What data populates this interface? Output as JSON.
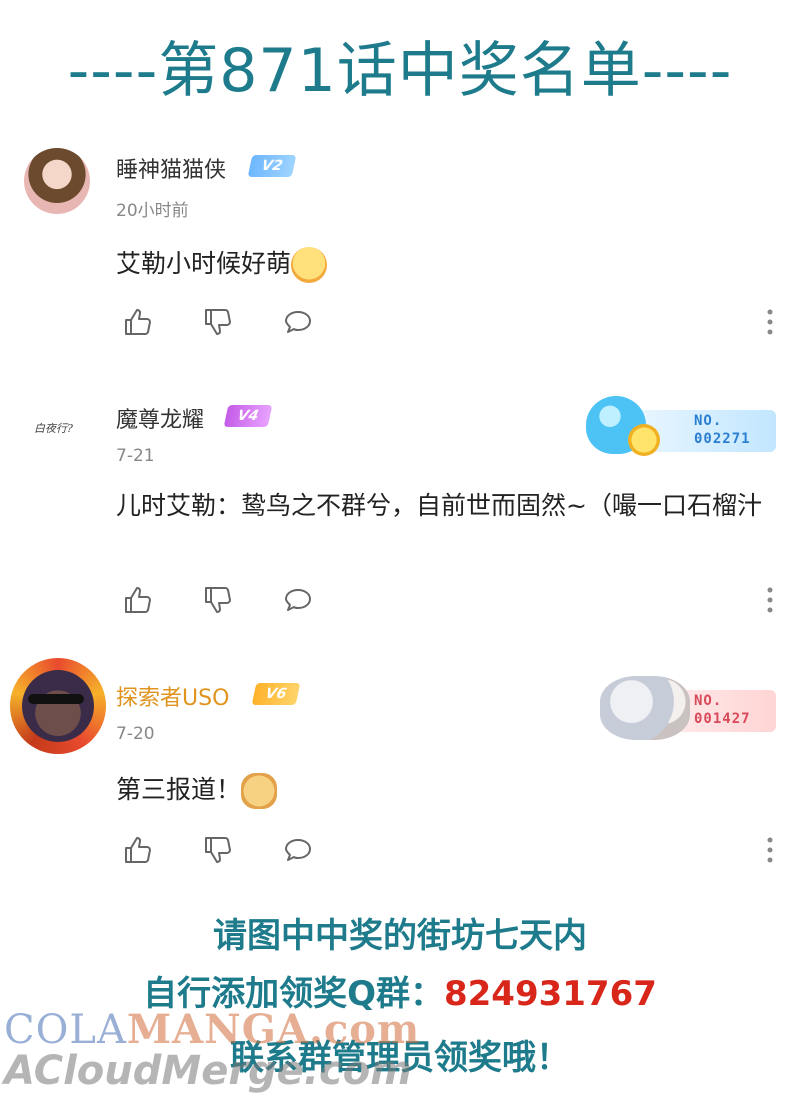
{
  "header": {
    "title": "----第871话中奖名单----"
  },
  "comments": [
    {
      "username": "睡神猫猫侠",
      "level": "V2",
      "time": "20小时前",
      "text": "艾勒小时候好萌",
      "emoji": "surprised-face-emoji"
    },
    {
      "username": "魔尊龙耀",
      "level": "V4",
      "time": "7-21",
      "text": "儿时艾勒：鸷鸟之不群兮，自前世而固然~（嘬一口石榴汁",
      "medal": {
        "label": "NO.",
        "number": "002271"
      },
      "avatar_text": "白夜行?"
    },
    {
      "username": "探索者USO",
      "level": "V6",
      "time": "7-20",
      "text": "第三报道！",
      "emoji": "doge-emoji",
      "medal": {
        "label": "NO.",
        "number": "001427"
      }
    }
  ],
  "footer": {
    "line1": "请图中中奖的街坊七天内",
    "line2_prefix": "自行添加领奖Q群：",
    "qq_group": "824931767",
    "line3": "联系群管理员领奖哦！"
  },
  "watermark": {
    "line1_a": "COLA",
    "line1_b": "MANGA",
    "line1_c": ".com",
    "line2": "ACloudMerge.com"
  },
  "colors": {
    "accent": "#1e7b8c",
    "highlight": "#d8261b",
    "gold_name": "#e0941f"
  },
  "icons": [
    "thumb-up-icon",
    "thumb-down-icon",
    "reply-bubble-icon",
    "more-vertical-icon"
  ]
}
